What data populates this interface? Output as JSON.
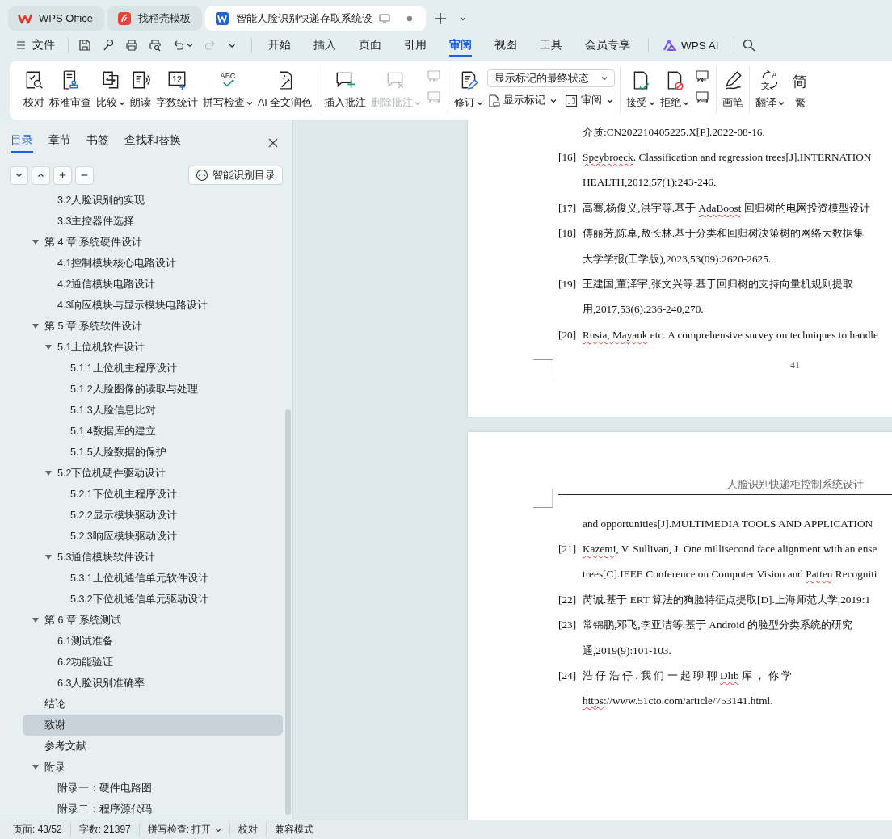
{
  "title_tabs": [
    {
      "label": "WPS Office",
      "selected": false
    },
    {
      "label": "找稻壳模板",
      "selected": false
    },
    {
      "label": "智能人脸识别快递存取系统设",
      "selected": true
    }
  ],
  "menu": {
    "file": "文件",
    "tabs": [
      {
        "label": "开始",
        "selected": false
      },
      {
        "label": "插入",
        "selected": false
      },
      {
        "label": "页面",
        "selected": false
      },
      {
        "label": "引用",
        "selected": false
      },
      {
        "label": "审阅",
        "selected": true
      },
      {
        "label": "视图",
        "selected": false
      },
      {
        "label": "工具",
        "selected": false
      },
      {
        "label": "会员专享",
        "selected": false
      }
    ],
    "ai": "WPS AI"
  },
  "ribbon": {
    "groups": [
      {
        "items": [
          {
            "kind": "big",
            "label": "校对",
            "dropdown": false,
            "disabled": false
          },
          {
            "kind": "big",
            "label": "标准审查",
            "dropdown": false,
            "disabled": false
          },
          {
            "kind": "big",
            "label": "比较",
            "dropdown": true,
            "disabled": false
          },
          {
            "kind": "big",
            "label": "朗读",
            "dropdown": false,
            "disabled": false
          },
          {
            "kind": "big",
            "label": "字数统计",
            "glyph": "12",
            "dropdown": false,
            "disabled": false
          },
          {
            "kind": "big",
            "label": "拼写检查",
            "glyph": "ABC",
            "dropdown": true,
            "disabled": false
          },
          {
            "kind": "big",
            "label": "AI 全文润色",
            "dropdown": false,
            "disabled": false
          }
        ]
      },
      {
        "items": [
          {
            "kind": "big",
            "label": "插入批注",
            "dropdown": false,
            "disabled": false
          },
          {
            "kind": "big",
            "label": "删除批注",
            "dropdown": true,
            "disabled": true
          },
          {
            "kind": "icons",
            "disabled": true
          }
        ]
      },
      {
        "items": [
          {
            "kind": "big",
            "label": "修订",
            "dropdown": true,
            "disabled": false
          },
          {
            "kind": "stack",
            "select": "显示标记的最终状态",
            "buttons": [
              {
                "label": "显示标记"
              },
              {
                "label": "审阅"
              }
            ]
          }
        ]
      },
      {
        "items": [
          {
            "kind": "big",
            "label": "接受",
            "dropdown": true,
            "disabled": false
          },
          {
            "kind": "big",
            "label": "拒绝",
            "dropdown": true,
            "disabled": false
          },
          {
            "kind": "icons",
            "disabled": false
          }
        ]
      },
      {
        "items": [
          {
            "kind": "big",
            "label": "画笔",
            "dropdown": false,
            "disabled": false
          }
        ]
      },
      {
        "items": [
          {
            "kind": "big",
            "label": "翻译",
            "glyph": "A文",
            "dropdown": true,
            "disabled": false
          },
          {
            "kind": "big",
            "label": "繁",
            "glyph": "简",
            "dropdown": false,
            "disabled": false
          }
        ]
      }
    ]
  },
  "sidebar": {
    "tabs": [
      {
        "label": "目录",
        "selected": true
      },
      {
        "label": "章节",
        "selected": false
      },
      {
        "label": "书签",
        "selected": false
      },
      {
        "label": "查找和替换",
        "selected": false
      }
    ],
    "smart_button": "智能识别目录",
    "toc": [
      {
        "children": [
          {
            "label": "3.2人脸识别的实现",
            "selected": false
          },
          {
            "label": "3.3主控器件选择",
            "selected": false
          }
        ]
      },
      {
        "label": "第 4 章 系统硬件设计",
        "selected": false,
        "expanded": true,
        "children": [
          {
            "label": "4.1控制模块核心电路设计",
            "selected": false
          },
          {
            "label": "4.2通信模块电路设计",
            "selected": false
          },
          {
            "label": "4.3响应模块与显示模块电路设计",
            "selected": false
          }
        ]
      },
      {
        "label": "第 5 章 系统软件设计",
        "selected": false,
        "expanded": true,
        "children": [
          {
            "label": "5.1上位机软件设计",
            "selected": false,
            "expanded": true,
            "children": [
              {
                "label": "5.1.1上位机主程序设计",
                "selected": false
              },
              {
                "label": "5.1.2人脸图像的读取与处理",
                "selected": false
              },
              {
                "label": "5.1.3人脸信息比对",
                "selected": false
              },
              {
                "label": "5.1.4数据库的建立",
                "selected": false
              },
              {
                "label": "5.1.5人脸数据的保护",
                "selected": false
              }
            ]
          },
          {
            "label": "5.2下位机硬件驱动设计",
            "selected": false,
            "expanded": true,
            "children": [
              {
                "label": "5.2.1下位机主程序设计",
                "selected": false
              },
              {
                "label": "5.2.2显示模块驱动设计",
                "selected": false
              },
              {
                "label": "5.2.3响应模块驱动设计",
                "selected": false
              }
            ]
          },
          {
            "label": "5.3通信模块软件设计",
            "selected": false,
            "expanded": true,
            "children": [
              {
                "label": "5.3.1上位机通信单元软件设计",
                "selected": false
              },
              {
                "label": "5.3.2下位机通信单元驱动设计",
                "selected": false
              }
            ]
          }
        ]
      },
      {
        "label": "第 6 章 系统测试",
        "selected": false,
        "expanded": true,
        "children": [
          {
            "label": "6.1测试准备",
            "selected": false
          },
          {
            "label": "6.2功能验证",
            "selected": false
          },
          {
            "label": "6.3人脸识别准确率",
            "selected": false
          }
        ]
      },
      {
        "label": "结论",
        "selected": false
      },
      {
        "label": "致谢",
        "selected": true
      },
      {
        "label": "参考文献",
        "selected": false
      },
      {
        "label": "附录",
        "selected": false,
        "expanded": true,
        "children": [
          {
            "label": "附录一：硬件电路图",
            "selected": false
          },
          {
            "label": "附录二：程序源代码",
            "selected": false
          }
        ]
      }
    ]
  },
  "pages": [
    {
      "lines": [
        {
          "text": "介质:CN202210405225.X[P].2022-08-16."
        },
        {
          "number": "[16]",
          "text": [
            {
              "text": "Speybroeck",
              "misspelled": true
            },
            {
              "text": ". Classification and regression trees[J].INTERNATION",
              "misspelled": false
            }
          ]
        },
        {
          "text": "HEALTH,2012,57(1):243-246."
        },
        {
          "number": "[17]",
          "text": [
            {
              "text": "高骞,杨俊义,洪宇等.基于 ",
              "misspelled": false
            },
            {
              "text": "AdaBoost",
              "misspelled": true
            },
            {
              "text": " 回归树的电网投资模型设计",
              "misspelled": false
            }
          ]
        },
        {
          "number": "[18]",
          "text": "傅丽芳,陈卓,敖长林.基于分类和回归树决策树的网络大数据集"
        },
        {
          "text": "大学学报(工学版),2023,53(09):2620-2625."
        },
        {
          "number": "[19]",
          "text": "王建国,董泽宇,张文兴等.基于回归树的支持向量机规则提取"
        },
        {
          "text": "用,2017,53(6):236-240,270."
        },
        {
          "number": "[20]",
          "text": [
            {
              "text": "Rusia,",
              "misspelled": true
            },
            {
              "text": " Mayank",
              "misspelled": true
            },
            {
              "text": " etc. A comprehensive survey on techniques to handle",
              "misspelled": false
            }
          ]
        }
      ],
      "page_number": "41"
    },
    {
      "header": "人脸识别快递柜控制系统设计",
      "lines": [
        {
          "text": "and opportunities[J].MULTIMEDIA TOOLS AND APPLICATION"
        },
        {
          "number": "[21]",
          "text": [
            {
              "text": "Kazemi",
              "misspelled": true
            },
            {
              "text": ", V. Sullivan, J. One millisecond face alignment with an ense",
              "misspelled": false
            }
          ]
        },
        {
          "text": [
            {
              "text": "trees[C].IEEE Conference on Computer Vision and ",
              "misspelled": false
            },
            {
              "text": "Patten",
              "misspelled": true
            },
            {
              "text": " Recogniti",
              "misspelled": false
            }
          ]
        },
        {
          "number": "[22]",
          "text": "芮诚.基于 ERT 算法的狗脸特征点提取[D].上海师范大学,2019:1"
        },
        {
          "number": "[23]",
          "text": "常锦鹏,邓飞,李亚洁等.基于  Android 的脸型分类系统的研究"
        },
        {
          "text": "通,2019(9):101-103."
        },
        {
          "number": "[24]",
          "text": [
            {
              "text": "浩 仔 浩 仔 .  我 们 一 起  聊 聊  ",
              "misspelled": false
            },
            {
              "text": "Dlib",
              "misspelled": true
            },
            {
              "text": "  库 ，  你 学",
              "misspelled": false
            }
          ]
        },
        {
          "text": [
            {
              "text": "https",
              "misspelled": true
            },
            {
              "text": "://www.51cto.com/article/753141.html.",
              "misspelled": false
            }
          ]
        }
      ]
    }
  ],
  "status_bar": [
    {
      "text": "页面: 43/52",
      "dropdown": false
    },
    {
      "text": "字数: 21397",
      "dropdown": false
    },
    {
      "text": "拼写检查: 打开",
      "dropdown": true
    },
    {
      "text": "校对",
      "dropdown": false
    },
    {
      "text": "兼容模式",
      "dropdown": false
    }
  ]
}
